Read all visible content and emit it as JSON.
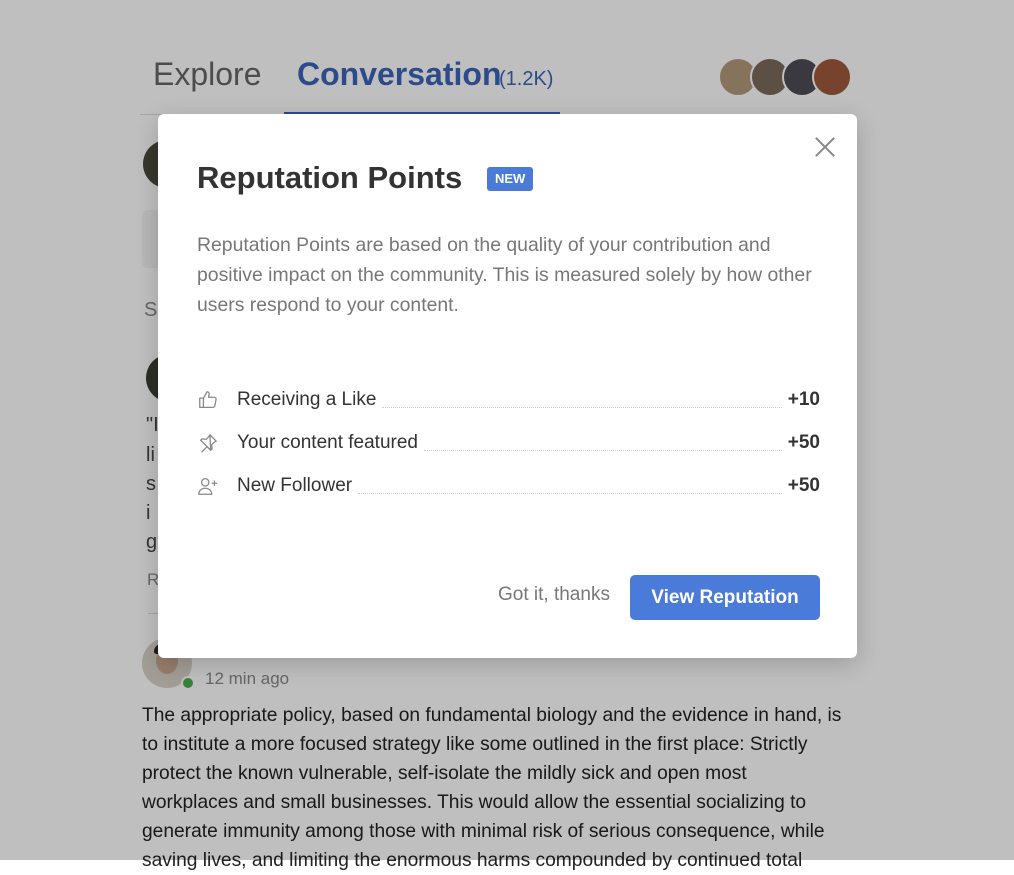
{
  "tabs": {
    "explore_label": "Explore",
    "conversation_label": "Conversation",
    "conversation_count": "(1.2K)"
  },
  "background": {
    "fragments": [
      "So",
      "\"I",
      "li",
      "s",
      "i",
      "g",
      "R"
    ],
    "post": {
      "timestamp": "12 min ago",
      "text": "The appropriate policy, based on fundamental biology and the evidence in hand, is to institute a more focused strategy like some outlined in the first place: Strictly protect the known vulnerable, self-isolate the mildly sick and open most workplaces and small businesses. This would allow the essential socializing to generate immunity among those with minimal risk of serious consequence, while saving lives, and limiting the enormous harms compounded by continued total"
    }
  },
  "modal": {
    "title": "Reputation Points",
    "badge": "NEW",
    "description": "Reputation Points are based on the quality of your contribution and positive impact on the community. This is measured solely by how other users respond to your content.",
    "points": [
      {
        "icon": "thumbs-up-icon",
        "label": "Receiving a Like",
        "value": "+10"
      },
      {
        "icon": "pin-icon",
        "label": "Your content featured",
        "value": "+50"
      },
      {
        "icon": "add-user-icon",
        "label": "New Follower",
        "value": "+50"
      }
    ],
    "secondary_button": "Got it, thanks",
    "primary_button": "View Reputation"
  },
  "colors": {
    "accent": "#4a7bd9",
    "tab_active": "#3d63b8",
    "overlay": "rgba(0,0,0,0.25)"
  }
}
